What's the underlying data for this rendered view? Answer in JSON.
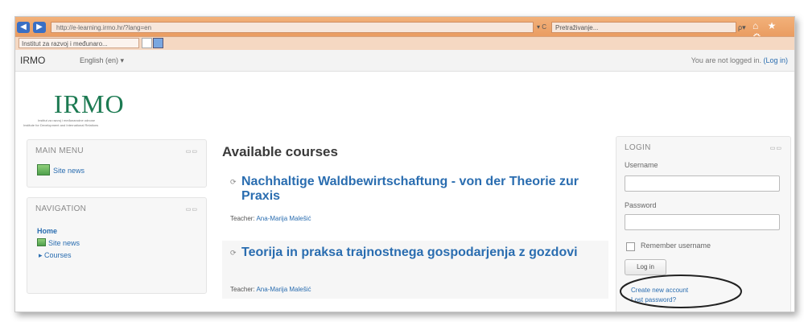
{
  "browser": {
    "url": "http://e-learning.irmo.hr/?lang=en",
    "url_controls": "▾ C",
    "search_placeholder": "Pretraživanje...",
    "search_icon": "ρ▾",
    "toolbar_icons": "⌂ ★ ⚙",
    "tab_label": "Institut za razvoj i međunaro..."
  },
  "header": {
    "brand": "IRMO",
    "language": "English (en) ▾",
    "login_status_prefix": "You are not logged in. ",
    "login_link": "(Log in)"
  },
  "logo": {
    "text": "IRMO",
    "subtitle1": "Institut za razvoj i međunarodne odnose",
    "subtitle2": "Institute for Development and International Relations"
  },
  "main_menu": {
    "title": "MAIN MENU",
    "controls": "▭▭",
    "items": [
      {
        "label": "Site news"
      }
    ]
  },
  "navigation": {
    "title": "NAVIGATION",
    "controls": "▭▭",
    "home": "Home",
    "items": [
      {
        "label": "Site news"
      },
      {
        "label": "▸ Courses"
      }
    ]
  },
  "main": {
    "title": "Available courses",
    "course_icon": "⟳",
    "courses": [
      {
        "title": "Nachhaltige Waldbewirtschaftung - von der Theorie zur Praxis",
        "teacher_prefix": "Teacher: ",
        "teacher_name": "Ana-Marija Malešić"
      },
      {
        "title": "Teorija in praksa trajnostnega gospodarjenja z gozdovi",
        "teacher_prefix": "Teacher: ",
        "teacher_name": "Ana-Marija Malešić"
      }
    ]
  },
  "login_block": {
    "title": "LOGIN",
    "controls": "▭▭",
    "username_label": "Username",
    "password_label": "Password",
    "remember_label": "Remember username",
    "login_button": "Log in",
    "create_account": "Create new account",
    "lost_password": "Lost password?"
  },
  "colors": {
    "link": "#2a6db0",
    "logo": "#1c7a52",
    "chrome": "#e48f52"
  }
}
